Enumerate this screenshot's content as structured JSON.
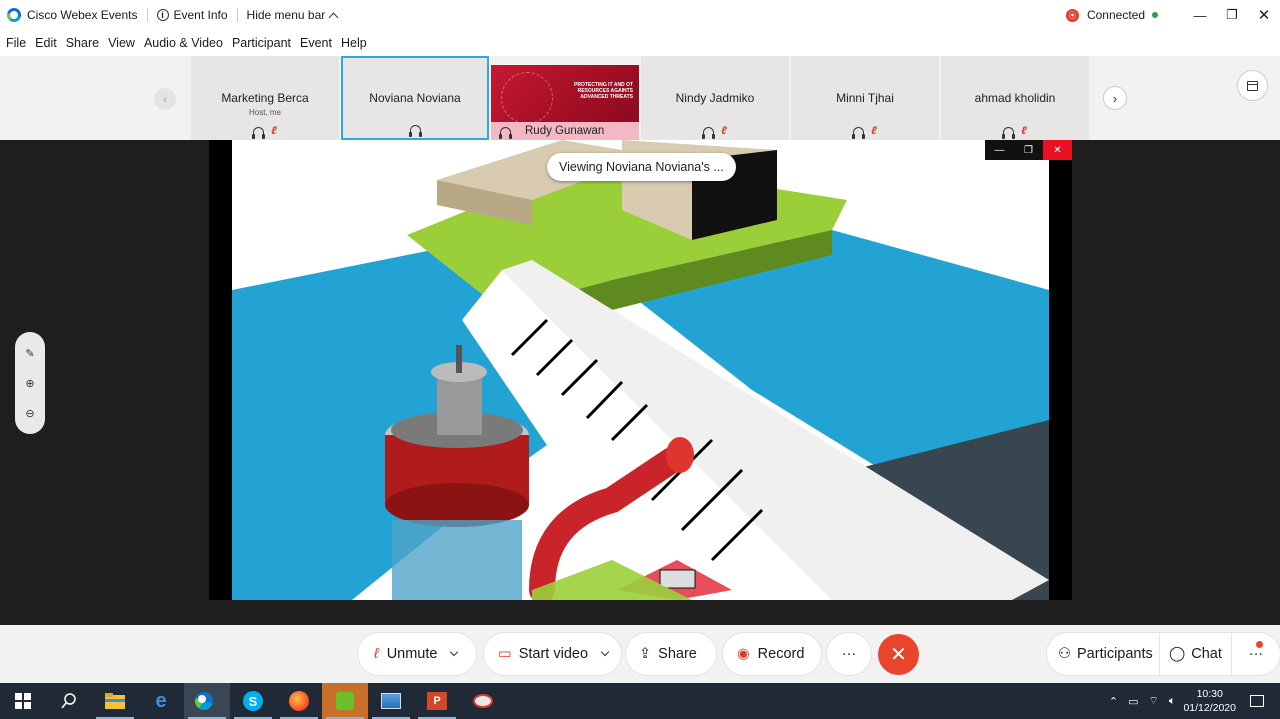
{
  "titlebar": {
    "app_name": "Cisco Webex Events",
    "event_info": "Event Info",
    "hide_menu": "Hide menu bar",
    "connection_status": "Connected"
  },
  "menu": [
    "File",
    "Edit",
    "Share",
    "View",
    "Audio & Video",
    "Participant",
    "Event",
    "Help"
  ],
  "participants": [
    {
      "name": "Marketing Berca",
      "role": "Host, me"
    },
    {
      "name": "Noviana Noviana",
      "role": ""
    },
    {
      "name": "Rudy Gunawan",
      "role": "",
      "share_text": "PROTECTING IT AND OT RESOURCES AGAINTS ADVANCED THREATS"
    },
    {
      "name": "Nindy Jadmiko",
      "role": ""
    },
    {
      "name": "Minni Tjhai",
      "role": ""
    },
    {
      "name": "ahmad kholidin",
      "role": ""
    }
  ],
  "stage": {
    "viewing_label": "Viewing Noviana Noviana's ..."
  },
  "controls": {
    "unmute": "Unmute",
    "start_video": "Start video",
    "share": "Share",
    "record": "Record",
    "more": "···",
    "participants": "Participants",
    "chat": "Chat"
  },
  "taskbar": {
    "time": "10:30",
    "date": "01/12/2020"
  },
  "colors": {
    "active_border": "#29abe2",
    "end_call": "#e8452c",
    "taskbar_bg": "#1f2a36",
    "water": "#23a3d4",
    "grass": "#9bcf3a"
  }
}
